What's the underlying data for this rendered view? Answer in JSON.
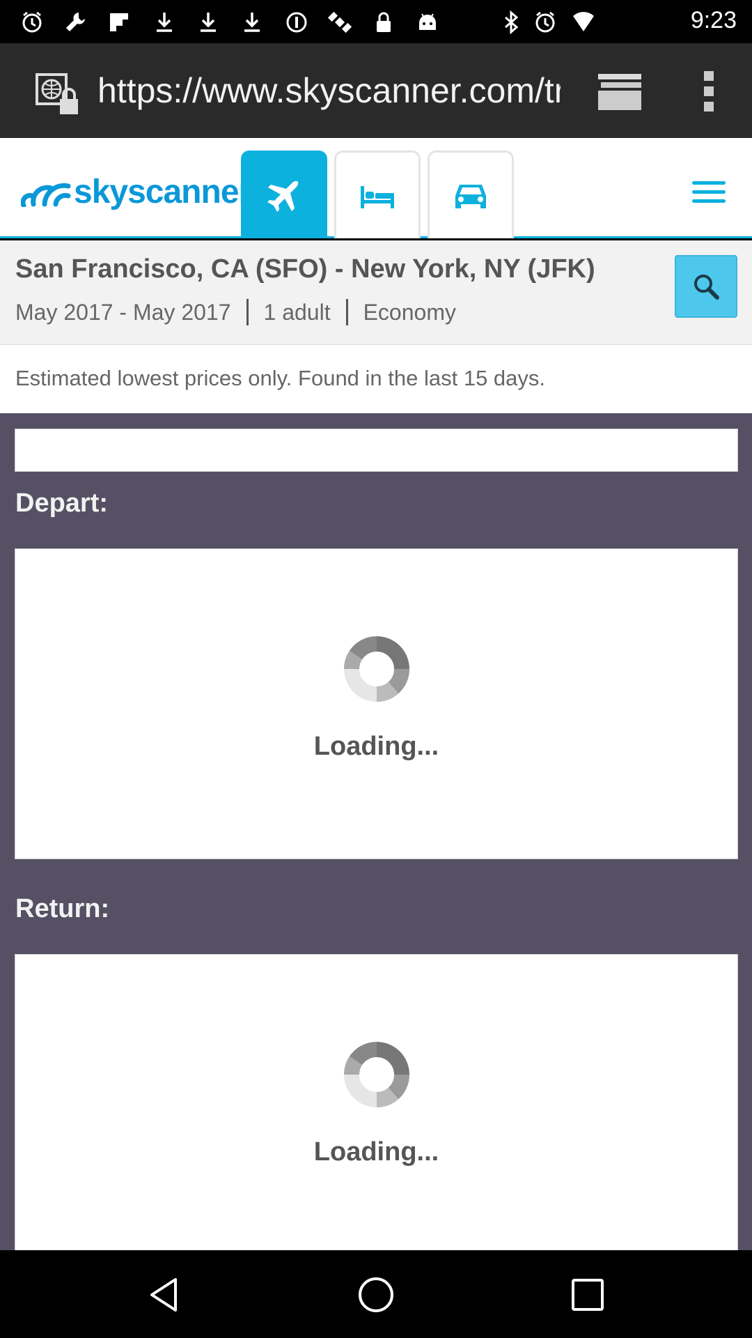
{
  "status_bar": {
    "time": "9:23",
    "icons": [
      "alarm-icon",
      "wrench-icon",
      "flipboard-icon",
      "download-icon",
      "download-icon",
      "download-icon",
      "data-saver-icon",
      "satellite-icon",
      "lock-icon",
      "android-icon",
      "bluetooth-icon",
      "alarm-icon",
      "wifi-signal-icon"
    ]
  },
  "browser": {
    "url": "https://www.skyscanner.com/transport/flights",
    "tabs_icon": "tabs-icon",
    "menu_icon": "overflow-menu-icon"
  },
  "header": {
    "logo_text": "skyscanner",
    "tabs": [
      {
        "icon": "flight-icon",
        "active": true
      },
      {
        "icon": "hotel-icon",
        "active": false
      },
      {
        "icon": "car-icon",
        "active": false
      }
    ],
    "accent_color": "#0cb1de"
  },
  "summary": {
    "route": "San Francisco, CA (SFO) - New York, NY (JFK)",
    "dates": "May 2017 - May 2017",
    "travellers": "1 adult",
    "cabin": "Economy"
  },
  "note": "Estimated lowest prices only. Found in the last 15 days.",
  "sections": {
    "depart_label": "Depart:",
    "depart_loading": "Loading...",
    "return_label": "Return:",
    "return_loading": "Loading..."
  },
  "nav": {
    "back": "back-icon",
    "home": "home-icon",
    "recents": "recents-icon"
  }
}
